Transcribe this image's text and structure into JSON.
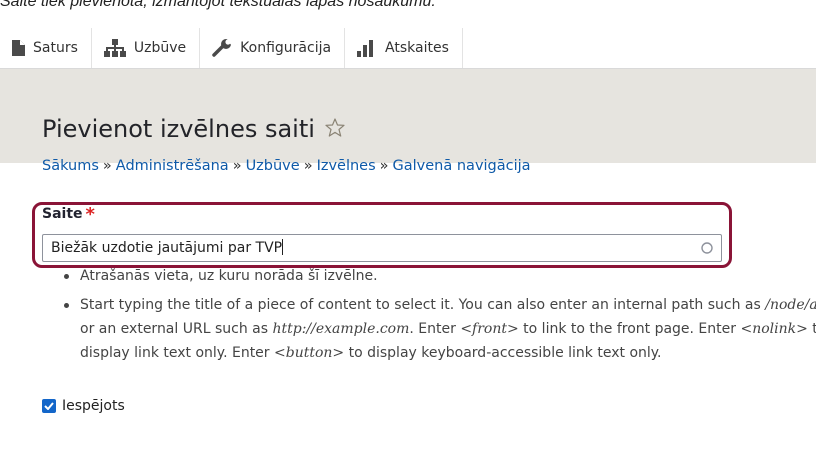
{
  "caption": "Saite tiek pievienota, izmantojot tekstuālās lapas nosaukumu.",
  "toolbar": {
    "items": [
      {
        "label": "Saturs",
        "icon": "file-icon"
      },
      {
        "label": "Uzbūve",
        "icon": "sitemap-icon"
      },
      {
        "label": "Konfigurācija",
        "icon": "wrench-icon"
      },
      {
        "label": "Atskaites",
        "icon": "bar-chart-icon"
      }
    ]
  },
  "page": {
    "title": "Pievienot izvēlnes saiti",
    "favorite_icon": "star-outline-icon"
  },
  "breadcrumb": {
    "items": [
      "Sākums",
      "Administrēšana",
      "Uzbūve",
      "Izvēlnes",
      "Galvenā navigācija"
    ],
    "separator": "»"
  },
  "link_field": {
    "label": "Saite",
    "required_marker": "*",
    "value": "Biežāk uzdotie jautājumi par TVP",
    "icon": "autocomplete-throbber-icon"
  },
  "description": {
    "item1": "Atrašanās vieta, uz kuru norāda šī izvēlne.",
    "item2": {
      "t1": "Start typing the title of a piece of content to select it. You can also enter an internal path such as ",
      "e1": "/node/add",
      "t2": " or an external URL such as ",
      "e2": "http://example.com",
      "t3": ". Enter ",
      "e3": "<front>",
      "t4": " to link to the front page. Enter ",
      "e4": "<nolink>",
      "t5": " to display link text only. Enter ",
      "e5": "<button>",
      "t6": " to display keyboard-accessible link text only."
    }
  },
  "enabled": {
    "label": "Iespējots",
    "checked": true
  },
  "colors": {
    "accent": "#1366c9",
    "highlight_border": "#8a1437",
    "link": "#0f5aa8",
    "header_bg": "#e6e4df",
    "required": "#dc2323"
  }
}
